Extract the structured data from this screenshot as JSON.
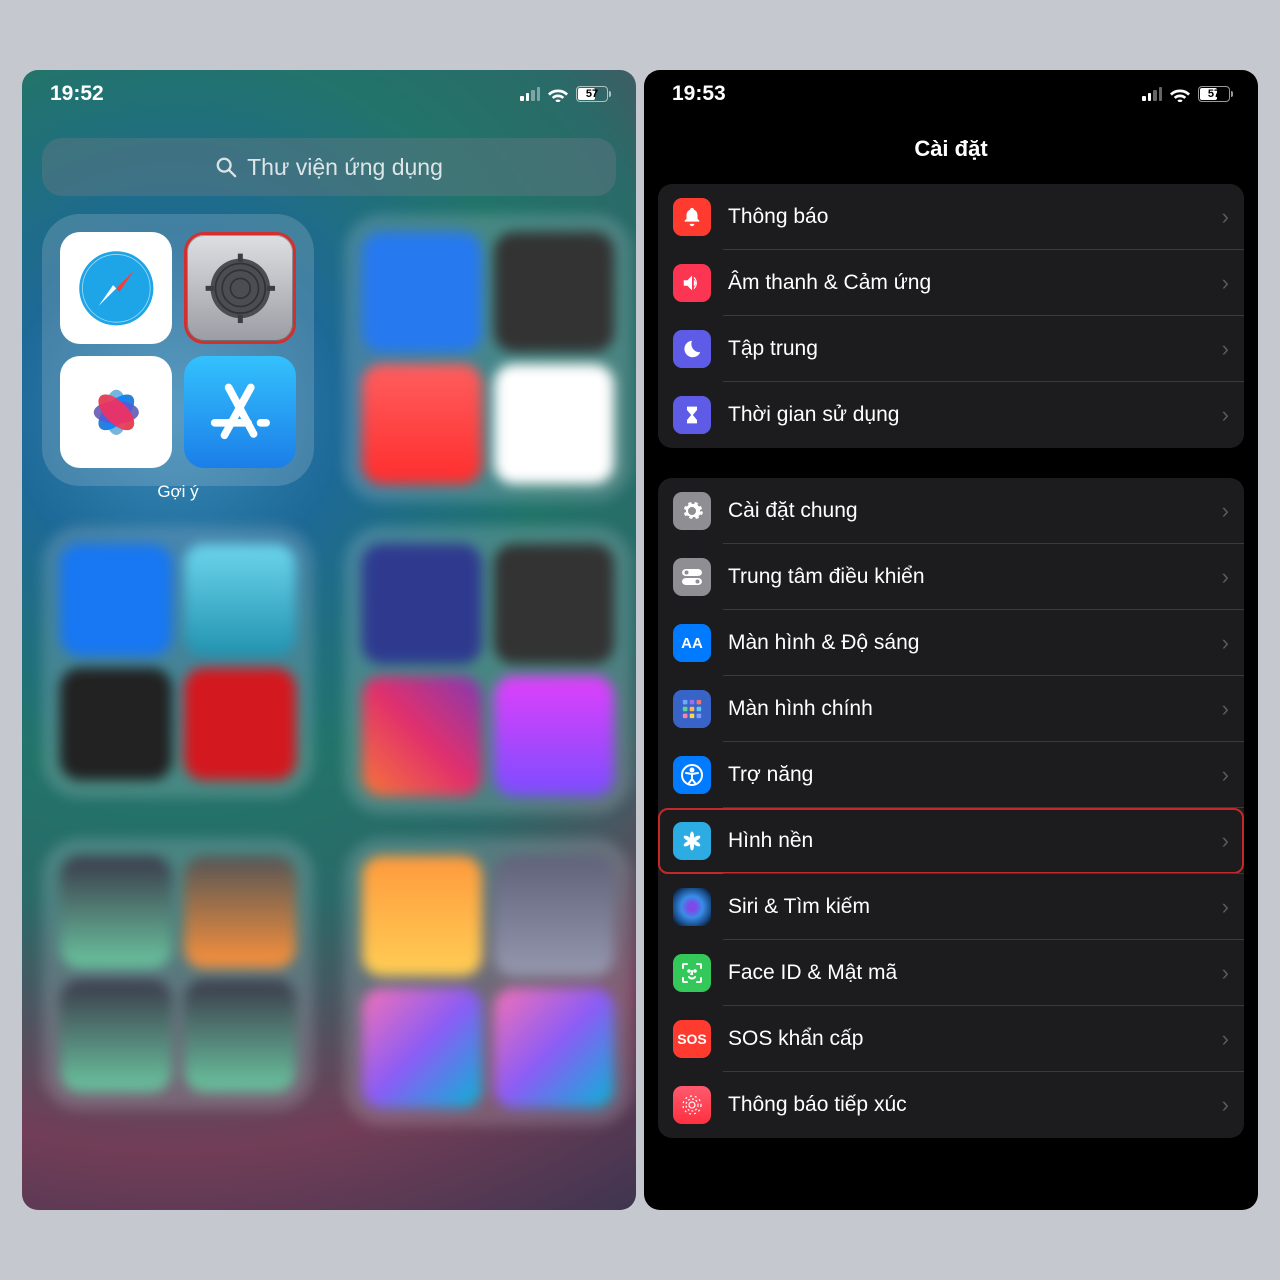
{
  "left": {
    "time": "19:52",
    "battery": "57",
    "search_placeholder": "Thư viện ứng dụng",
    "suggestions_label": "Gợi ý",
    "apps": {
      "safari": "Safari",
      "settings": "Settings",
      "photos": "Photos",
      "appstore": "App Store"
    }
  },
  "right": {
    "time": "19:53",
    "battery": "57",
    "title": "Cài đặt",
    "section1": [
      {
        "key": "noti",
        "label": "Thông báo",
        "icon": "bell-icon"
      },
      {
        "key": "sound",
        "label": "Âm thanh & Cảm ứng",
        "icon": "speaker-icon"
      },
      {
        "key": "focus",
        "label": "Tập trung",
        "icon": "moon-icon"
      },
      {
        "key": "time",
        "label": "Thời gian sử dụng",
        "icon": "hourglass-icon"
      }
    ],
    "section2": [
      {
        "key": "general",
        "label": "Cài đặt chung",
        "icon": "gear-icon"
      },
      {
        "key": "cc",
        "label": "Trung tâm điều khiển",
        "icon": "toggle-icon"
      },
      {
        "key": "display",
        "label": "Màn hình & Độ sáng",
        "icon": "aa-icon",
        "text": "AA"
      },
      {
        "key": "home",
        "label": "Màn hình chính",
        "icon": "grid-icon"
      },
      {
        "key": "access",
        "label": "Trợ năng",
        "icon": "person-icon"
      },
      {
        "key": "wall",
        "label": "Hình nền",
        "icon": "flower-icon",
        "highlight": true
      },
      {
        "key": "siri",
        "label": "Siri & Tìm kiếm",
        "icon": "siri-icon"
      },
      {
        "key": "face",
        "label": "Face ID & Mật mã",
        "icon": "face-icon"
      },
      {
        "key": "sos",
        "label": "SOS khẩn cấp",
        "icon": "sos-icon",
        "text": "SOS"
      },
      {
        "key": "expo",
        "label": "Thông báo tiếp xúc",
        "icon": "exposure-icon"
      }
    ]
  }
}
